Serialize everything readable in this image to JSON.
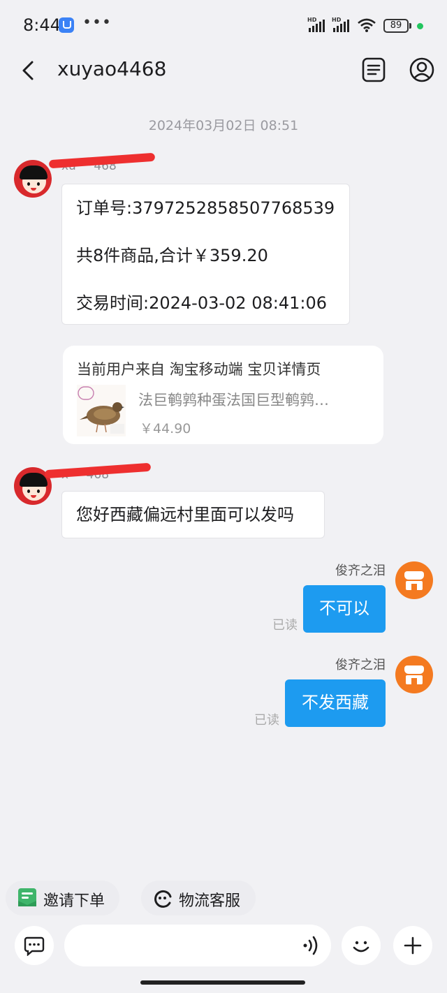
{
  "status_bar": {
    "time": "8:44",
    "battery": "89"
  },
  "header": {
    "title": "xuyao4468"
  },
  "timestamp": "2024年03月02日 08:51",
  "messages": {
    "order": {
      "sender_name": "xu   468",
      "lines": [
        "订单号:3797252858507768539",
        "共8件商品,合计￥359.20",
        "交易时间:2024-03-02 08:41:06"
      ]
    },
    "product": {
      "source": "当前用户来自 淘宝移动端 宝贝详情页",
      "name": "法巨鹌鹑种蛋法国巨型鹌鹑…",
      "price": "￥44.90"
    },
    "customer_msg": {
      "sender_name": "x   468",
      "text": "您好西藏偏远村里面可以发吗"
    },
    "reply1": {
      "sender_name": "俊齐之泪",
      "text": "不可以",
      "status": "已读"
    },
    "reply2": {
      "sender_name": "俊齐之泪",
      "text": "不发西藏",
      "status": "已读"
    }
  },
  "quick_actions": [
    {
      "label": "邀请下单"
    },
    {
      "label": "物流客服"
    }
  ],
  "colors": {
    "bubble_blue": "#1d9bf0",
    "shop_orange": "#f47a20",
    "invite_green": "#3fb56b"
  }
}
